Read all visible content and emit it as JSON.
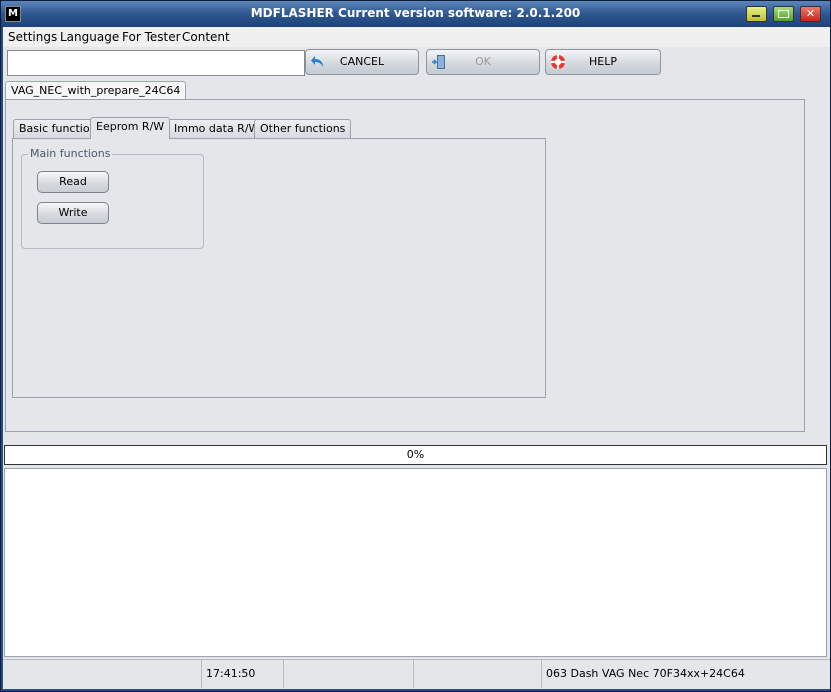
{
  "window": {
    "title": "MDFLASHER  Current version software: 2.0.1.200",
    "app_icon_glyph": "M",
    "close_glyph": "✕"
  },
  "menu": [
    "Settings",
    "Language",
    "For Tester",
    "Content"
  ],
  "toolbar": {
    "input_value": "",
    "cancel_label": "CANCEL",
    "ok_label": "OK",
    "help_label": "HELP"
  },
  "document_tab": "VAG_NEC_with_prepare_24C64",
  "tabs": [
    "Basic functions",
    "Eeprom R/W",
    "Immo data R/W",
    "Other functions"
  ],
  "active_tab_index": 1,
  "main_functions": {
    "label": "Main functions",
    "read_label": "Read",
    "write_label": "Write"
  },
  "progress": {
    "percent": 0,
    "label": "0%"
  },
  "status": {
    "time": "17:41:50",
    "device": "063 Dash VAG Nec 70F34xx+24C64"
  },
  "icons": {
    "cancel": "undo-arrow-icon",
    "ok": "exit-door-icon",
    "help": "lifebuoy-icon"
  }
}
